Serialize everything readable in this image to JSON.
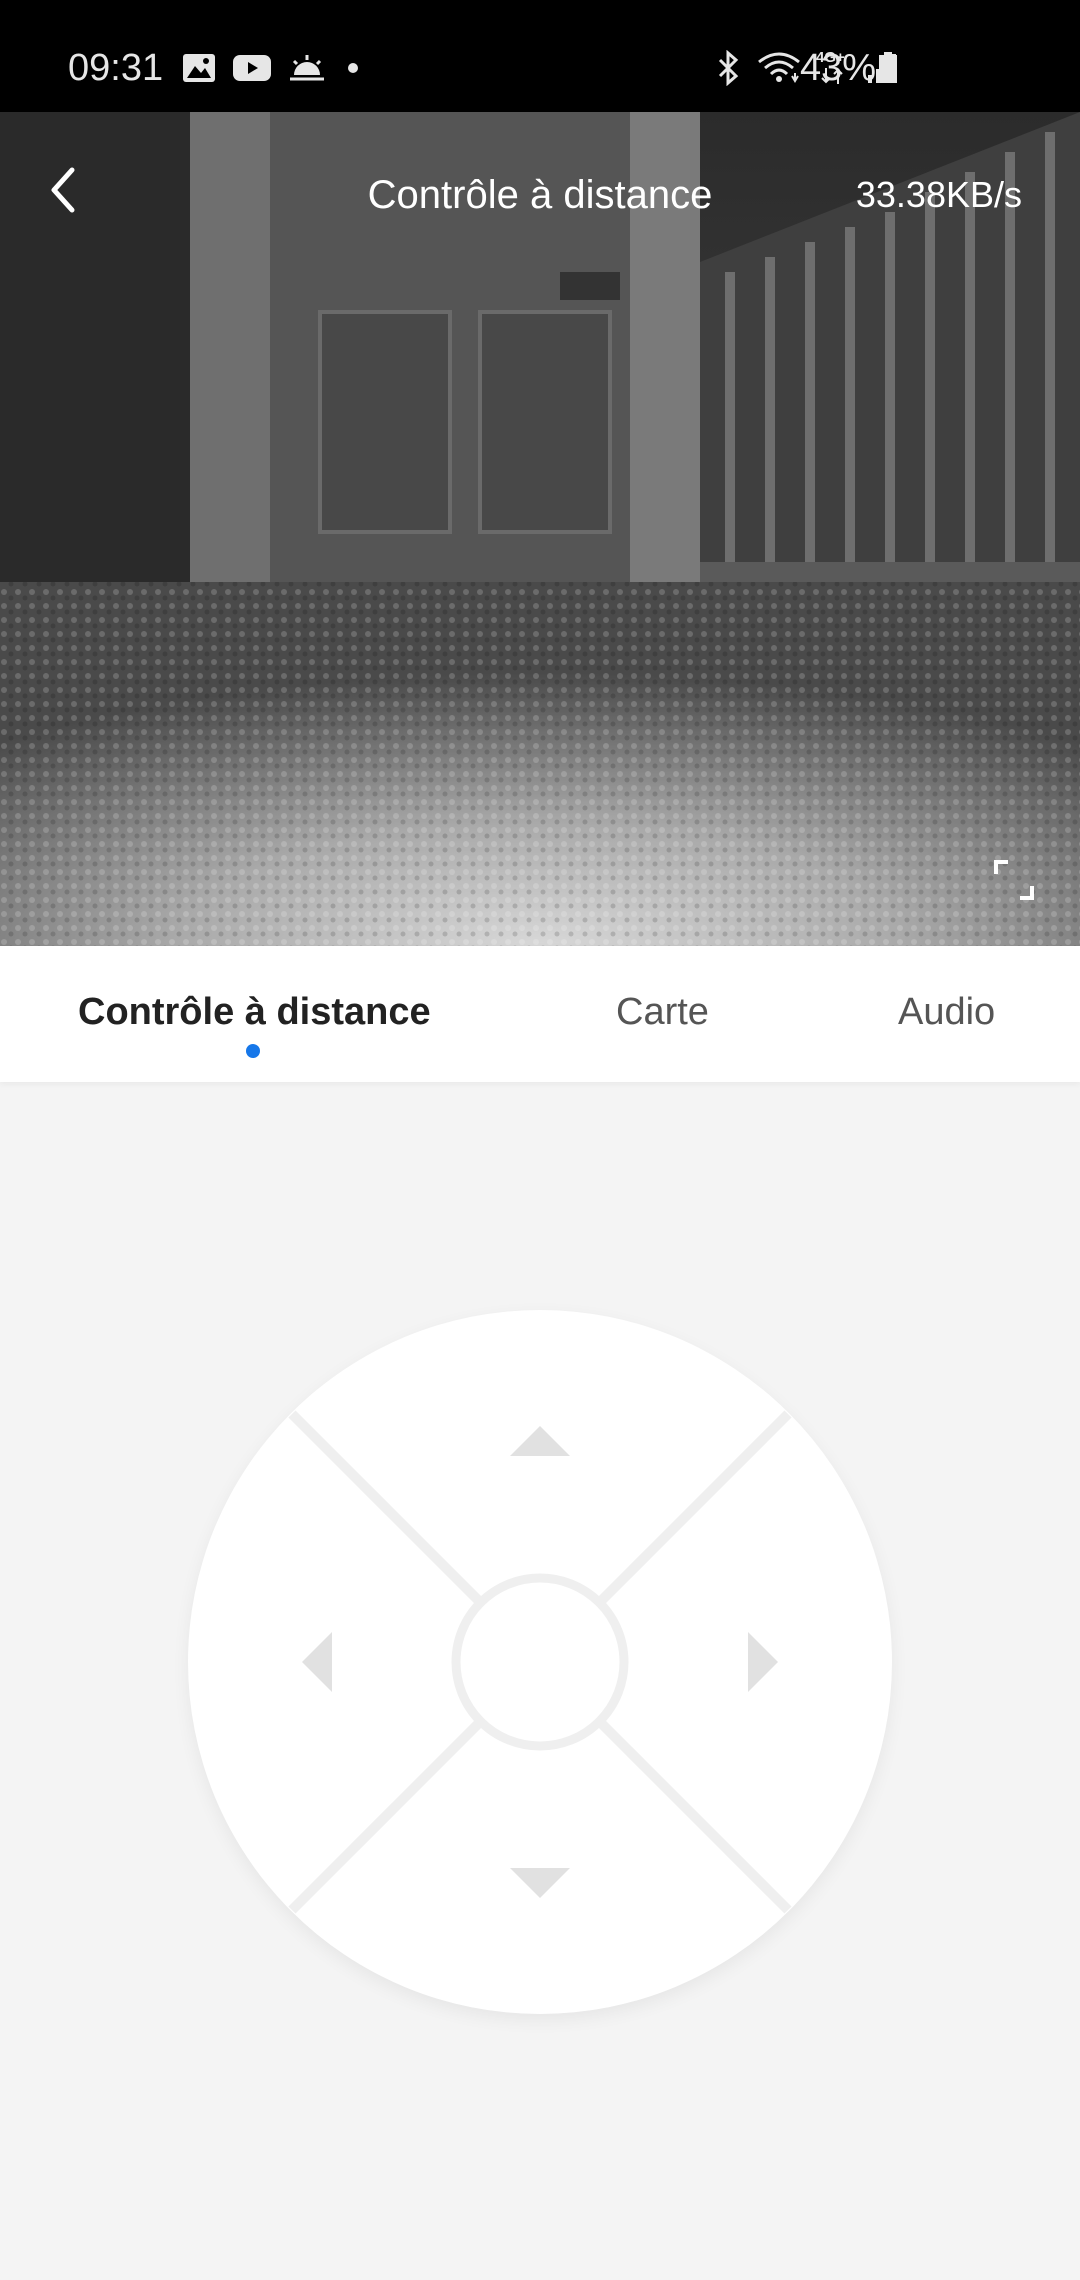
{
  "status_bar": {
    "time": "09:31",
    "battery": "43%",
    "icons_left": [
      "gallery-icon",
      "youtube-icon",
      "weather-icon",
      "dot-icon"
    ],
    "icons_right": [
      "bluetooth-icon",
      "wifi-icon",
      "4g-icon",
      "signal-icon"
    ],
    "network_label": "4G+"
  },
  "camera": {
    "title": "Contrôle à distance",
    "speed": "33.38KB/s"
  },
  "tabs": [
    {
      "label": "Contrôle à distance",
      "active": true
    },
    {
      "label": "Carte",
      "active": false
    },
    {
      "label": "Audio",
      "active": false
    }
  ],
  "colors": {
    "accent": "#1677e9",
    "background": "#f4f4f4"
  }
}
